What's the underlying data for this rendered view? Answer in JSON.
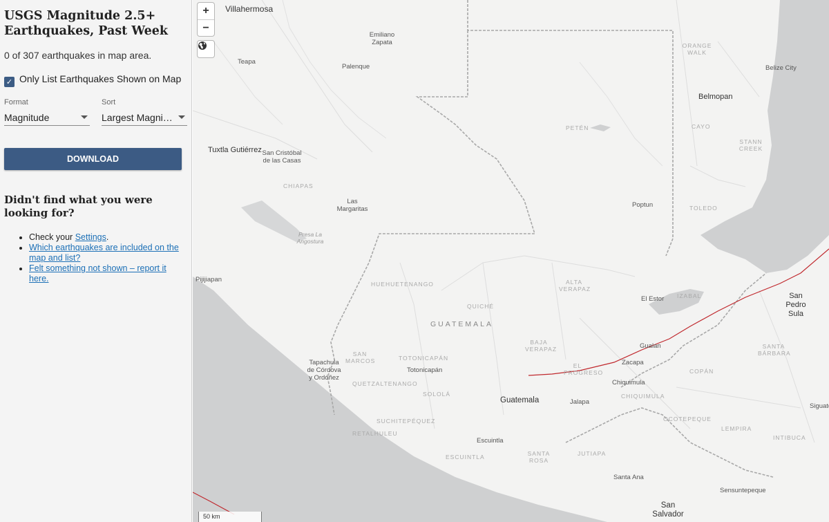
{
  "sidebar": {
    "title": "USGS Magnitude 2.5+ Earthquakes, Past Week",
    "count_text": "0 of 307 earthquakes in map area.",
    "checkbox_label": "Only List Earthquakes Shown on Map",
    "checkbox_checked": true,
    "format": {
      "caption": "Format",
      "value": "Magnitude"
    },
    "sort": {
      "caption": "Sort",
      "value": "Largest Magnitude"
    },
    "download_label": "DOWNLOAD",
    "help_title": "Didn't find what you were looking for?",
    "help_items": {
      "check_prefix": "Check your ",
      "settings_link": "Settings",
      "check_suffix": ".",
      "which_link": "Which earthquakes are included on the map and list?",
      "felt_link": "Felt something not shown – report it here."
    }
  },
  "map": {
    "zoom_in": "+",
    "zoom_out": "−",
    "scale": "50 km",
    "labels": {
      "villahermosa": "Villahermosa",
      "emiliano": "Emiliano Zapata",
      "teapa": "Teapa",
      "palenque": "Palenque",
      "orange_walk": "ORANGE WALK",
      "belize_city": "Belize City",
      "belmopan": "Belmopan",
      "cayo": "CAYO",
      "stann_creek": "STANN CREEK",
      "peten": "PETÉN",
      "tuxtla": "Tuxtla Gutiérrez",
      "san_cristobal": "San Cristóbal de las Casas",
      "chiapas": "CHIAPAS",
      "las_margaritas": "Las Margaritas",
      "poptun": "Poptun",
      "toledo": "TOLEDO",
      "presa": "Presa La Angostura",
      "pijijiapan": "Pijijiapan",
      "huehuetenango": "HUEHUETENANGO",
      "alta_verapaz": "ALTA VERAPAZ",
      "el_estor": "El Estor",
      "izabal": "IZABAL",
      "san_pedro_sula": "San Pedro Sula",
      "quiche": "QUICHÉ",
      "guatemala_country": "GUATEMALA",
      "baja_verapaz": "BAJA VERAPAZ",
      "gualan": "Gualan",
      "santa_barbara": "SANTA BÁRBARA",
      "tapachula": "Tapachula de Córdova y Ordóñez",
      "san_marcos": "SAN MARCOS",
      "totonicapan_region": "TOTONICAPÁN",
      "totonicapan_city": "Totonicapán",
      "el_progreso": "EL PROGRESO",
      "zacapa": "Zacapa",
      "copan": "COPÁN",
      "quetzaltenango": "QUETZALTENANGO",
      "chiquimula_city": "Chiquimula",
      "solola": "SOLOLÁ",
      "guatemala_city": "Guatemala",
      "jalapa": "Jalapa",
      "chiquimula_region": "CHIQUIMULA",
      "siguatepeque": "Siguatepe",
      "suchitepequez": "SUCHITEPÉQUEZ",
      "ocotepeque": "OCOTEPEQUE",
      "lempira": "LEMPIRA",
      "intibuca": "INTIBUCA",
      "retalhuleu": "RETALHULEU",
      "escuintla_city": "Escuintla",
      "escuintla_region": "ESCUINTLA",
      "santa_rosa": "SANTA ROSA",
      "jutiapa": "JUTIAPA",
      "santa_ana": "Santa Ana",
      "sonsonate": "Sensuntepeque",
      "san_salvador": "San Salvador"
    }
  },
  "colors": {
    "accent": "#3c5b84",
    "link": "#1b6fb6",
    "fault_line": "#c0282d",
    "water": "#cfd0d1",
    "land": "#f3f3f2"
  }
}
